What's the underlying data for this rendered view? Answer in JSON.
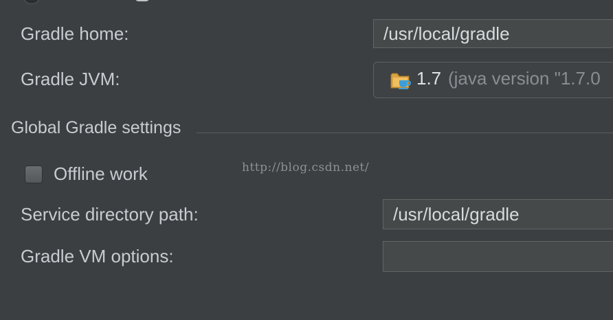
{
  "settings": {
    "gradle_home_label": "Gradle home:",
    "gradle_home_value": "/usr/local/gradle",
    "gradle_jvm_label": "Gradle JVM:",
    "gradle_jvm_version": "1.7",
    "gradle_jvm_detail": "(java version \"1.7.0",
    "jdk_icon": "jdk-folder-icon"
  },
  "global": {
    "section_title": "Global Gradle settings",
    "offline_work_label": "Offline work",
    "offline_work_checked": false,
    "service_dir_label": "Service directory path:",
    "service_dir_value": "/usr/local/gradle",
    "vm_options_label": "Gradle VM options:",
    "vm_options_value": ""
  },
  "watermark": "http://blog.csdn.net/",
  "colors": {
    "background": "#3c3f41",
    "field_background": "#45494a",
    "text": "#c8ccd0",
    "detail_text": "#8a8e92"
  }
}
